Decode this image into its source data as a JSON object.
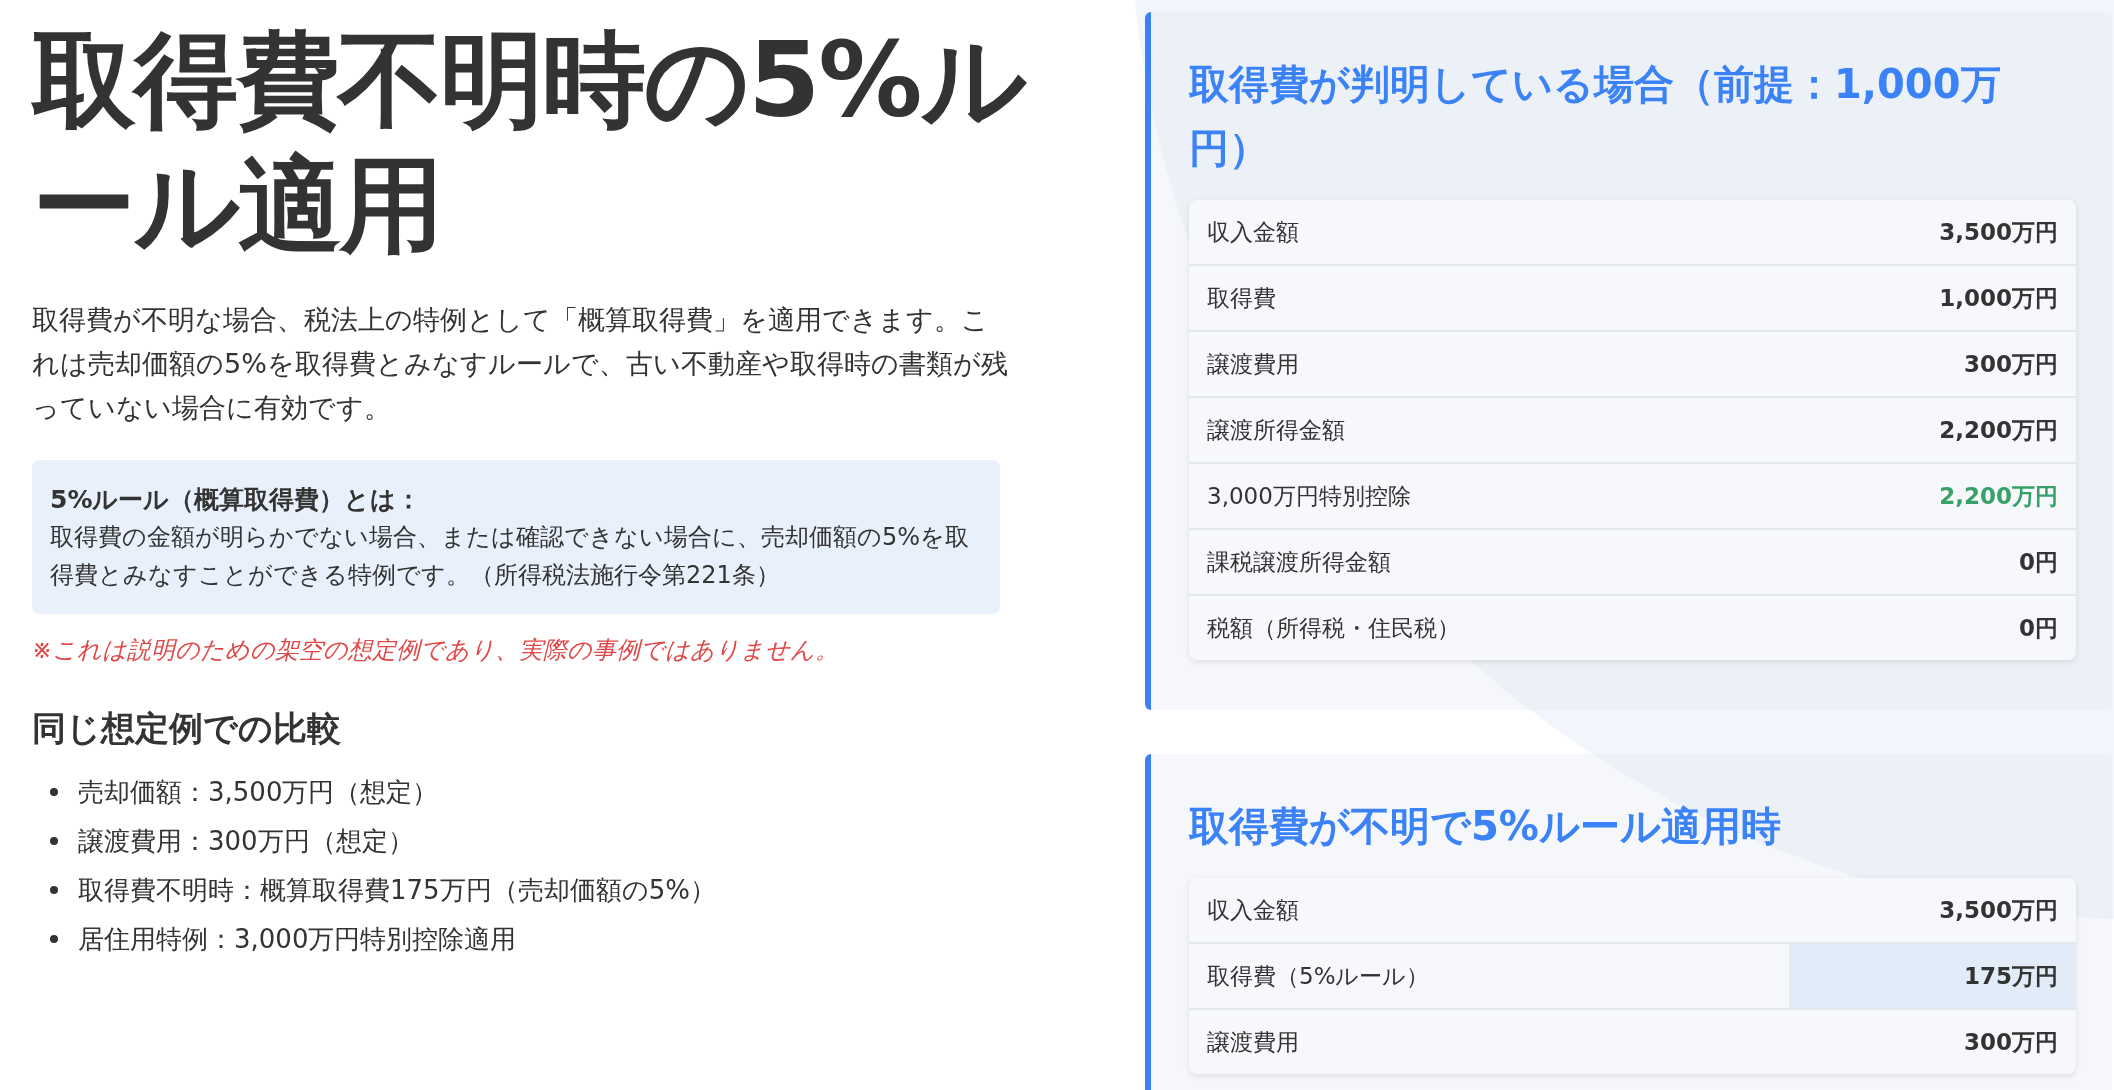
{
  "title": "取得費不明時の5%ルール適用",
  "intro": "取得費が不明な場合、税法上の特例として「概算取得費」を適用できます。これは売却価額の5%を取得費とみなすルールで、古い不動産や取得時の書類が残っていない場合に有効です。",
  "callout": {
    "heading": "5%ルール（概算取得費）とは：",
    "body": "取得費の金額が明らかでない場合、または確認できない場合に、売却価額の5%を取得費とみなすことができる特例です。（所得税法施行令第221条）"
  },
  "disclaimer": "※これは説明のための架空の想定例であり、実際の事例ではありません。",
  "comparison": {
    "heading": "同じ想定例での比較",
    "items": [
      "売却価額：3,500万円（想定）",
      "譲渡費用：300万円（想定）",
      "取得費不明時：概算取得費175万円（売却価額の5%）",
      "居住用特例：3,000万円特別控除適用"
    ]
  },
  "panels": [
    {
      "heading": "取得費が判明している場合（前提：1,000万円）",
      "rows": [
        {
          "label": "収入金額",
          "value": "3,500万円",
          "kind": "normal",
          "highlighted": false
        },
        {
          "label": "取得費",
          "value": "1,000万円",
          "kind": "normal",
          "highlighted": false
        },
        {
          "label": "譲渡費用",
          "value": "300万円",
          "kind": "normal",
          "highlighted": false
        },
        {
          "label": "譲渡所得金額",
          "value": "2,200万円",
          "kind": "normal",
          "highlighted": false
        },
        {
          "label": "3,000万円特別控除",
          "value": "2,200万円",
          "kind": "deduction",
          "highlighted": false
        },
        {
          "label": "課税譲渡所得金額",
          "value": "0円",
          "kind": "normal",
          "highlighted": false
        },
        {
          "label": "税額（所得税・住民税）",
          "value": "0円",
          "kind": "normal",
          "highlighted": false
        }
      ]
    },
    {
      "heading": "取得費が不明で5%ルール適用時",
      "rows": [
        {
          "label": "収入金額",
          "value": "3,500万円",
          "kind": "normal",
          "highlighted": false
        },
        {
          "label": "取得費（5%ルール）",
          "value": "175万円",
          "kind": "normal",
          "highlighted": true
        },
        {
          "label": "譲渡費用",
          "value": "300万円",
          "kind": "normal",
          "highlighted": false
        }
      ]
    }
  ]
}
